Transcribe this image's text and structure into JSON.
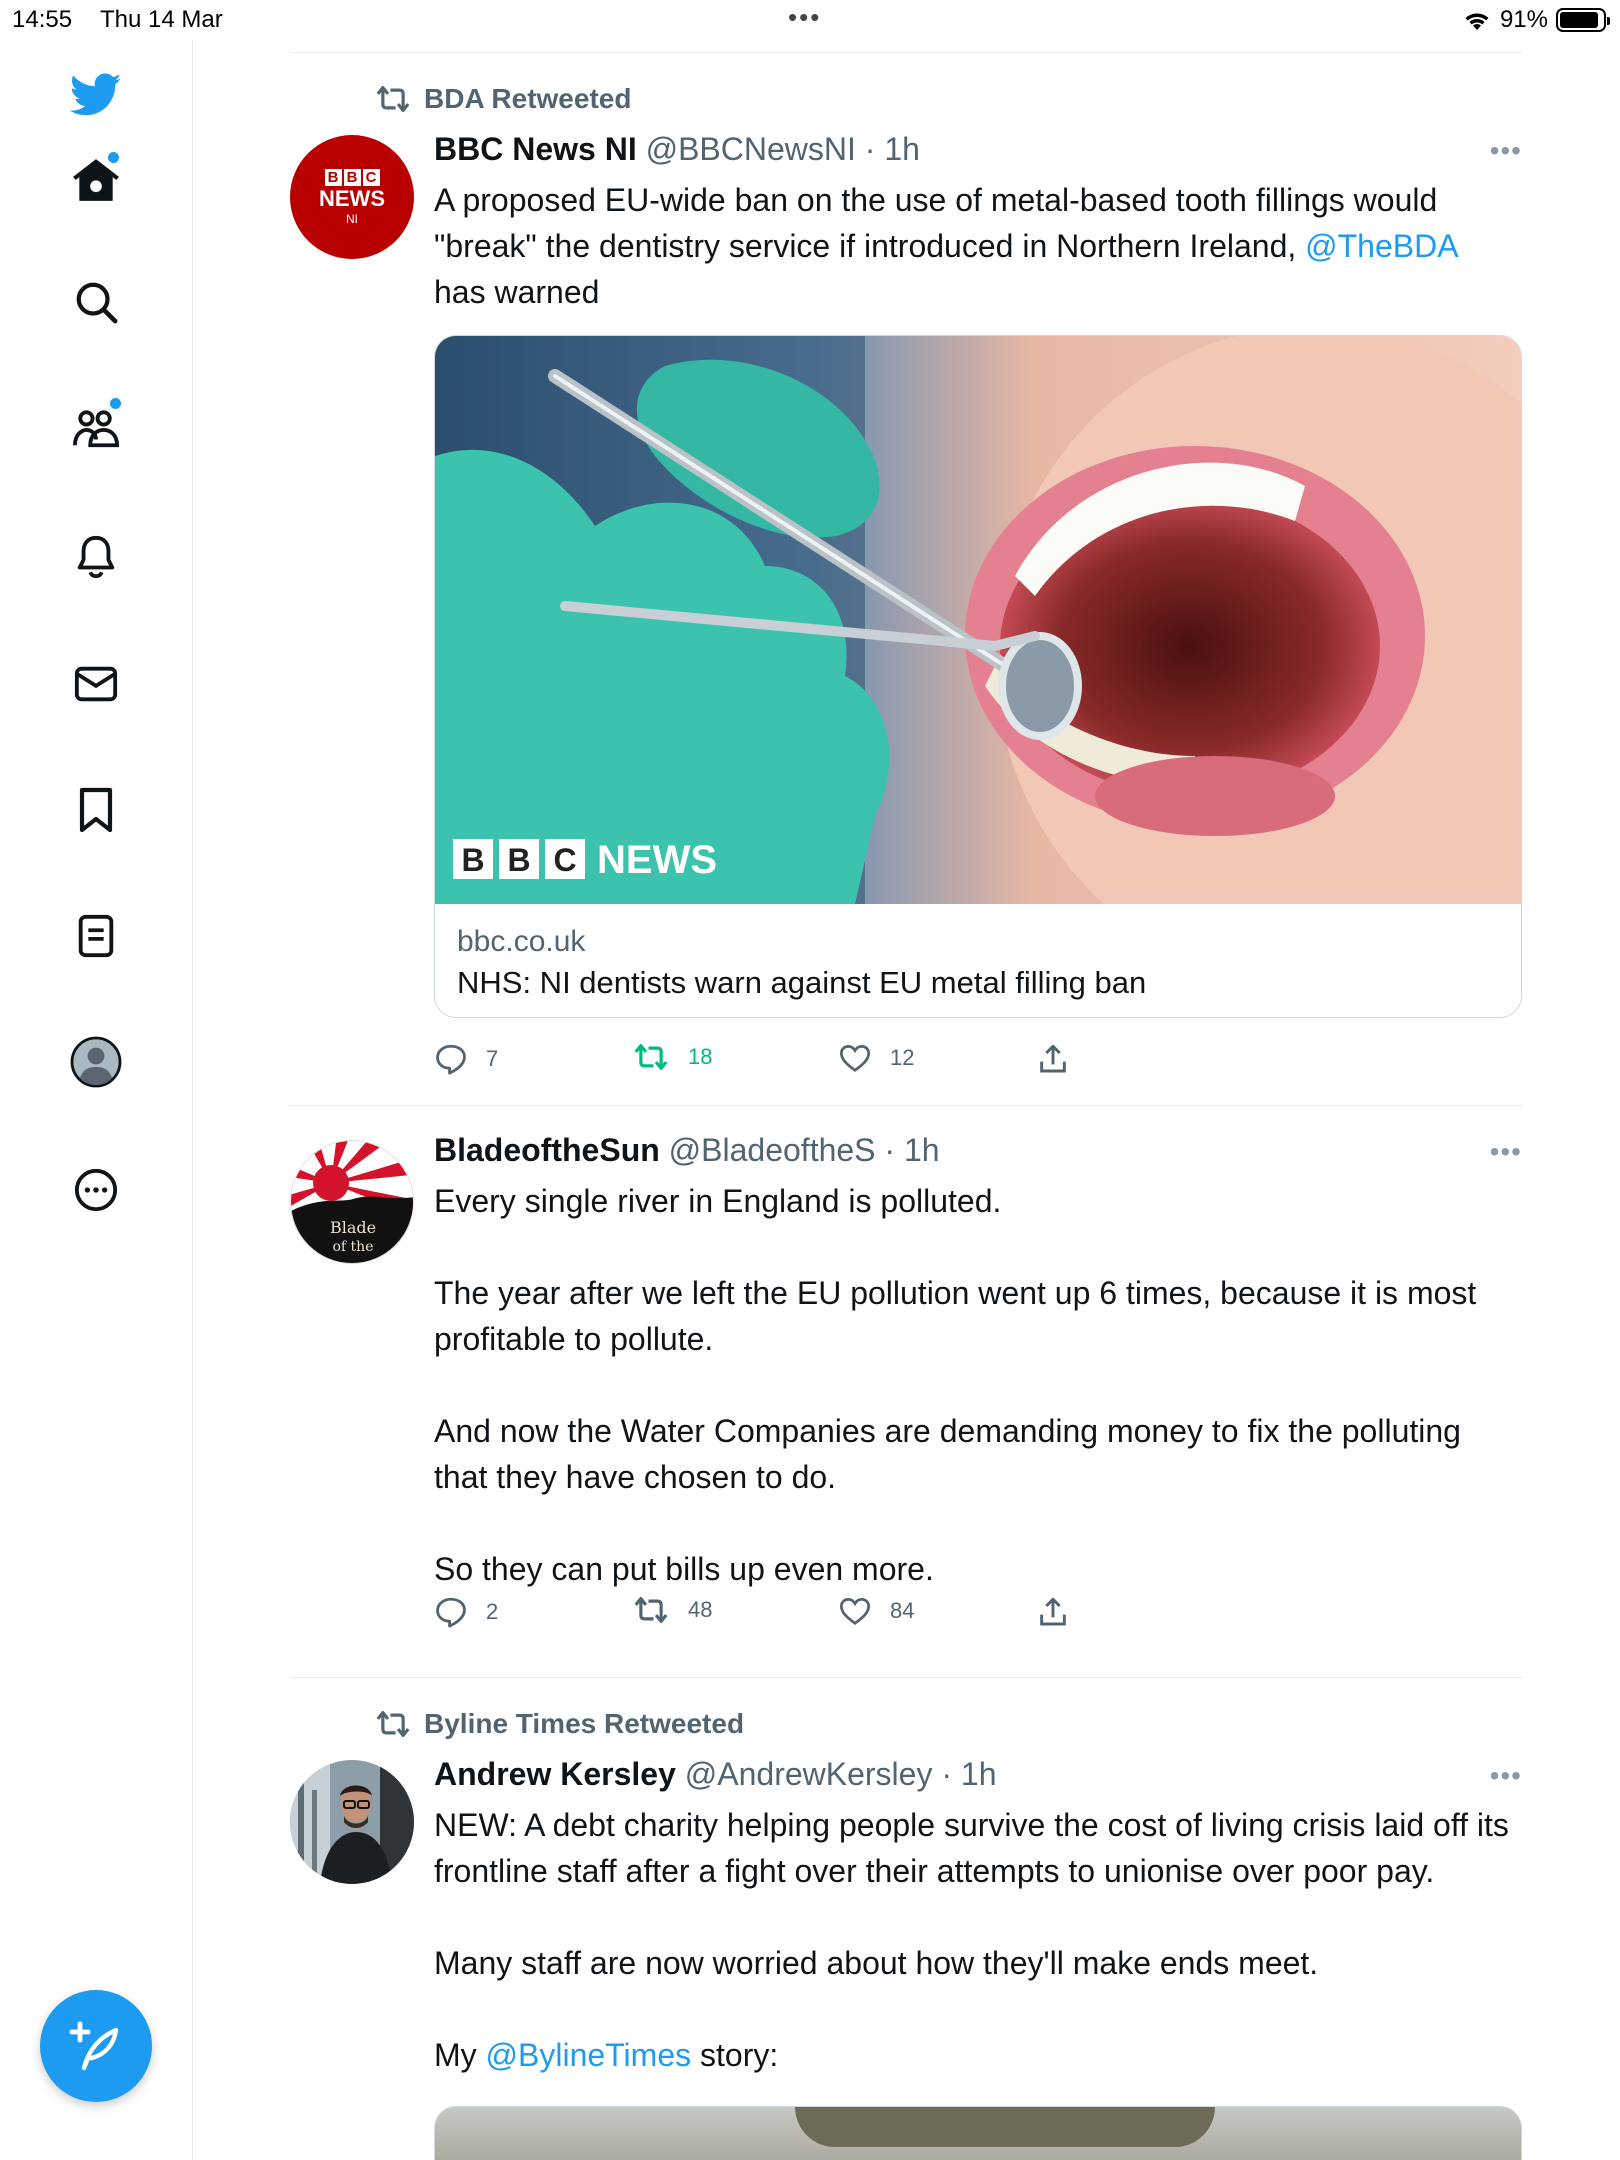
{
  "status_bar": {
    "time": "14:55",
    "date": "Thu 14 Mar",
    "battery": "91%",
    "battery_level": 0.91
  },
  "sidebar": {
    "items": [
      {
        "icon": "twitter-bird-icon"
      },
      {
        "icon": "home-icon",
        "badge": true
      },
      {
        "icon": "search-icon"
      },
      {
        "icon": "communities-icon",
        "badge": true
      },
      {
        "icon": "notifications-bell-icon"
      },
      {
        "icon": "messages-envelope-icon"
      },
      {
        "icon": "bookmark-icon"
      },
      {
        "icon": "lists-icon"
      },
      {
        "icon": "profile-avatar-icon"
      },
      {
        "icon": "more-circle-icon"
      }
    ],
    "compose_icon": "compose-tweet-icon"
  },
  "colors": {
    "accent": "#1d9bf0",
    "retweet_active": "#00ba7c",
    "muted": "#536471",
    "divider": "#e6ecf0"
  },
  "tweets": [
    {
      "retweeted_by": "BDA Retweeted",
      "name": "BBC News NI",
      "meta": "@BBCNewsNI · 1h",
      "avatar_text": {
        "blocks": "BBC",
        "line1": "NEWS",
        "line2": "NI"
      },
      "text_before": "A proposed EU-wide ban on the use of metal-based tooth fillings would \"break\" the dentistry service if introduced in Northern Ireland, ",
      "mention": "@TheBDA",
      "text_after": " has warned",
      "card": {
        "watermark_blocks": "BBC",
        "watermark_word": "NEWS",
        "domain": "bbc.co.uk",
        "title": "NHS: NI dentists warn against EU metal filling ban"
      },
      "stats": {
        "replies": "7",
        "retweets": "18",
        "likes": "12"
      },
      "retweeted": true
    },
    {
      "name": "BladeoftheSun",
      "meta": "@BladeoftheS · 1h",
      "avatar_text": {
        "line1": "Blade",
        "line2": "of the"
      },
      "text": "Every single river in England is polluted.\n\nThe year after we left the EU pollution went up 6 times, because it is most profitable to pollute.\n\nAnd now the Water Companies are demanding money to fix the polluting that they have chosen to do.\n\nSo they can put bills up even more.",
      "stats": {
        "replies": "2",
        "retweets": "48",
        "likes": "84"
      },
      "retweeted": false
    },
    {
      "retweeted_by": "Byline Times Retweeted",
      "name": "Andrew Kersley",
      "meta": "@AndrewKersley · 1h",
      "text_main": "NEW: A debt charity helping people survive the cost of living crisis laid off its frontline staff after a fight over their attempts to unionise over poor pay.\n\nMany staff are now worried about how they'll make ends meet.\n\n",
      "text_prefix": "My ",
      "mention": "@BylineTimes",
      "text_suffix": " story:"
    }
  ]
}
